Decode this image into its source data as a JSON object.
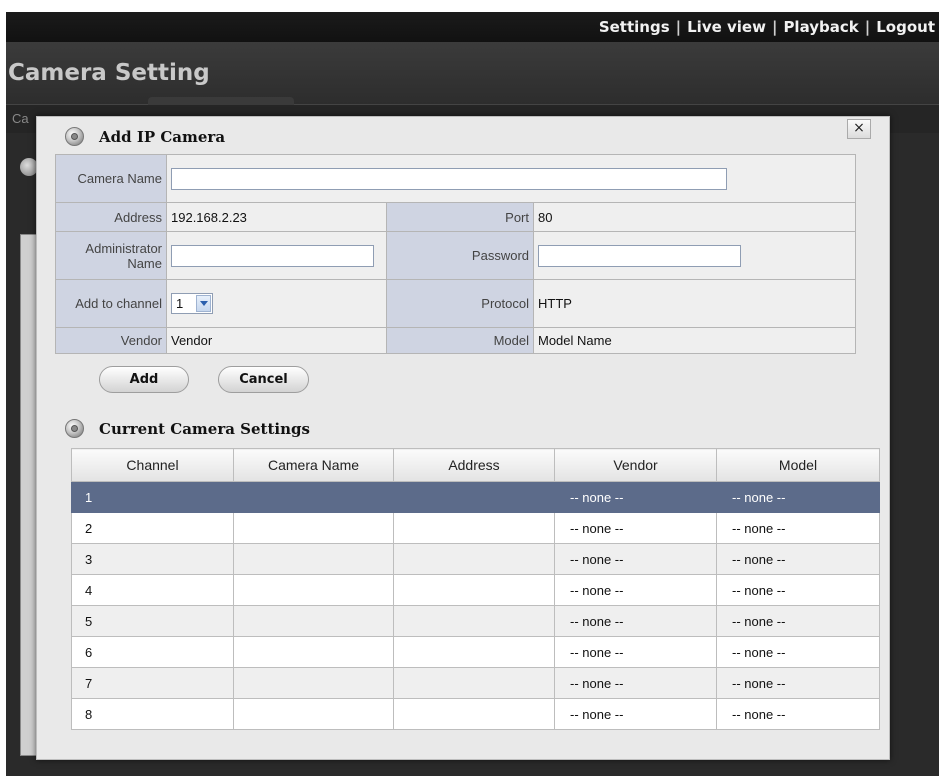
{
  "nav": {
    "settings": "Settings",
    "live_view": "Live view",
    "playback": "Playback",
    "logout": "Logout",
    "sep": "|"
  },
  "page_title": "Camera Setting",
  "subtab_label": "Ca",
  "dialog": {
    "title": "Add IP Camera",
    "close": "×",
    "form": {
      "camera_name_label": "Camera Name",
      "camera_name_value": "",
      "address_label": "Address",
      "address_value": "192.168.2.23",
      "port_label": "Port",
      "port_value": "80",
      "admin_name_label": "Administrator Name",
      "admin_name_value": "",
      "password_label": "Password",
      "password_value": "",
      "channel_label": "Add to channel",
      "channel_value": "1",
      "protocol_label": "Protocol",
      "protocol_value": "HTTP",
      "vendor_label": "Vendor",
      "vendor_value": "Vendor",
      "model_label": "Model",
      "model_value": "Model Name"
    },
    "add_button": "Add",
    "cancel_button": "Cancel"
  },
  "current": {
    "title": "Current Camera Settings",
    "columns": [
      "Channel",
      "Camera Name",
      "Address",
      "Vendor",
      "Model"
    ],
    "selected_row": 0,
    "rows": [
      [
        "1",
        "",
        "",
        "-- none --",
        "-- none --"
      ],
      [
        "2",
        "",
        "",
        "-- none --",
        "-- none --"
      ],
      [
        "3",
        "",
        "",
        "-- none --",
        "-- none --"
      ],
      [
        "4",
        "",
        "",
        "-- none --",
        "-- none --"
      ],
      [
        "5",
        "",
        "",
        "-- none --",
        "-- none --"
      ],
      [
        "6",
        "",
        "",
        "-- none --",
        "-- none --"
      ],
      [
        "7",
        "",
        "",
        "-- none --",
        "-- none --"
      ],
      [
        "8",
        "",
        "",
        "-- none --",
        "-- none --"
      ]
    ]
  }
}
